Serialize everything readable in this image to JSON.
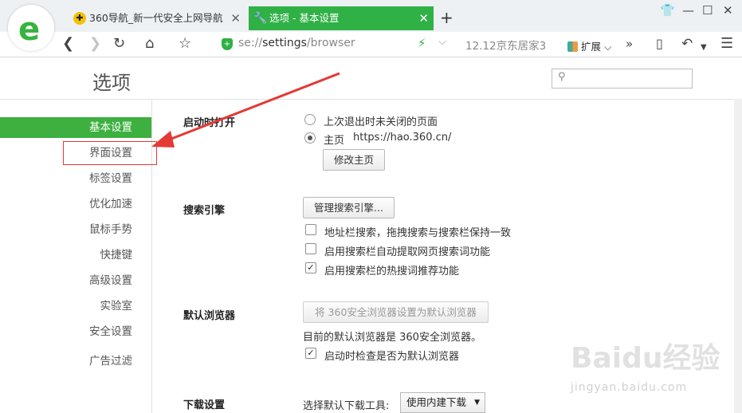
{
  "tabs": [
    {
      "label": "360导航_新一代安全上网导航",
      "active": false
    },
    {
      "label": "选项 - 基本设置",
      "active": true
    }
  ],
  "toolbar": {
    "url_scheme": "se://",
    "url_path": "settings",
    "url_tail": "/browser",
    "hot_search": "12.12京东居家3",
    "extensions_label": "扩展"
  },
  "page": {
    "title": "选项",
    "search_placeholder": ""
  },
  "sidebar": {
    "items": [
      {
        "label": "基本设置",
        "active": true
      },
      {
        "label": "界面设置",
        "active": false
      },
      {
        "label": "标签设置",
        "active": false
      },
      {
        "label": "优化加速",
        "active": false
      },
      {
        "label": "鼠标手势",
        "active": false
      },
      {
        "label": "快捷键",
        "active": false
      },
      {
        "label": "高级设置",
        "active": false
      },
      {
        "label": "实验室",
        "active": false
      },
      {
        "label": "安全设置",
        "active": false
      },
      {
        "label": "广告过滤",
        "active": false
      }
    ]
  },
  "startup": {
    "label": "启动时打开",
    "option_last": "上次退出时未关闭的页面",
    "option_home": "主页",
    "home_url": "https://hao.360.cn/",
    "selected": "home",
    "edit_home_button": "修改主页"
  },
  "search_engine": {
    "label": "搜索引擎",
    "manage_button": "管理搜索引擎...",
    "options": [
      {
        "label": "地址栏搜索，拖拽搜索与搜索栏保持一致",
        "checked": false
      },
      {
        "label": "启用搜索栏自动提取网页搜索词功能",
        "checked": false
      },
      {
        "label": "启用搜索栏的热搜词推荐功能",
        "checked": true
      }
    ]
  },
  "default_browser": {
    "label": "默认浏览器",
    "set_default_button": "将 360安全浏览器设置为默认浏览器",
    "status_text": "目前的默认浏览器是 360安全浏览器。",
    "check_on_start": {
      "label": "启动时检查是否为默认浏览器",
      "checked": true
    }
  },
  "download": {
    "label": "下载设置",
    "tool_label": "选择默认下载工具:",
    "tool_value": "使用内建下载"
  },
  "watermark": {
    "text": "Baidu经验",
    "sub": "jingyan.baidu.com"
  },
  "colors": {
    "accent": "#3db03f",
    "tab_active": "#2fb146",
    "annotation_red": "#e53935"
  }
}
